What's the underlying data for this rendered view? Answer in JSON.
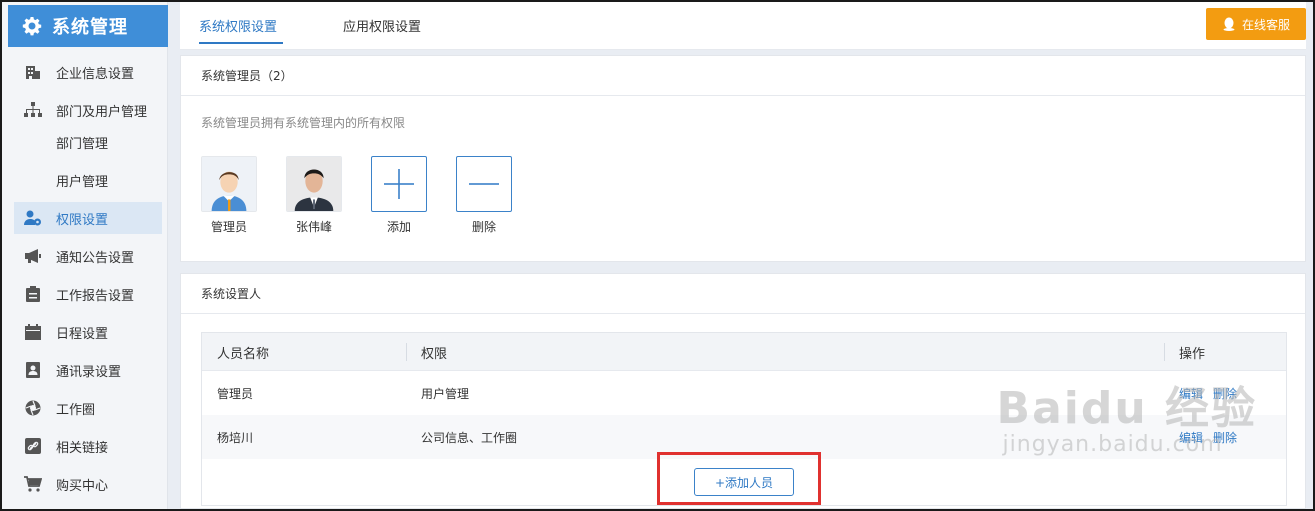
{
  "sidebar": {
    "title": "系统管理",
    "items": [
      {
        "label": "企业信息设置",
        "icon": "building-icon"
      },
      {
        "label": "部门及用户管理",
        "icon": "org-chart-icon"
      },
      {
        "label": "部门管理",
        "icon": ""
      },
      {
        "label": "用户管理",
        "icon": ""
      },
      {
        "label": "权限设置",
        "icon": "user-permission-icon"
      },
      {
        "label": "通知公告设置",
        "icon": "megaphone-icon"
      },
      {
        "label": "工作报告设置",
        "icon": "clipboard-icon"
      },
      {
        "label": "日程设置",
        "icon": "calendar-icon"
      },
      {
        "label": "通讯录设置",
        "icon": "contacts-icon"
      },
      {
        "label": "工作圈",
        "icon": "aperture-icon"
      },
      {
        "label": "相关链接",
        "icon": "link-icon"
      },
      {
        "label": "购买中心",
        "icon": "cart-icon"
      }
    ],
    "active": "权限设置",
    "accent": "#3f8ed8"
  },
  "tabs": [
    {
      "label": "系统权限设置",
      "active": true
    },
    {
      "label": "应用权限设置",
      "active": false
    }
  ],
  "service_button": "在线客服",
  "admins_section": {
    "title": "系统管理员（2）",
    "description": "系统管理员拥有系统管理内的所有权限",
    "members": [
      {
        "name": "管理员"
      },
      {
        "name": "张伟峰"
      }
    ],
    "add_label": "添加",
    "delete_label": "删除"
  },
  "settings_section": {
    "title": "系统设置人",
    "columns": [
      "人员名称",
      "权限",
      "操作"
    ],
    "rows": [
      {
        "name": "管理员",
        "permission": "用户管理",
        "edit": "编辑",
        "delete": "删除"
      },
      {
        "name": "杨培川",
        "permission": "公司信息、工作圈",
        "edit": "编辑",
        "delete": "删除"
      }
    ],
    "add_person": "+添加人员"
  },
  "watermark": {
    "brand": "Baidu 经验",
    "url": "jingyan.baidu.com"
  },
  "colors": {
    "link": "#2f79c4",
    "service": "#f39c11",
    "highlight": "#e0312f"
  }
}
